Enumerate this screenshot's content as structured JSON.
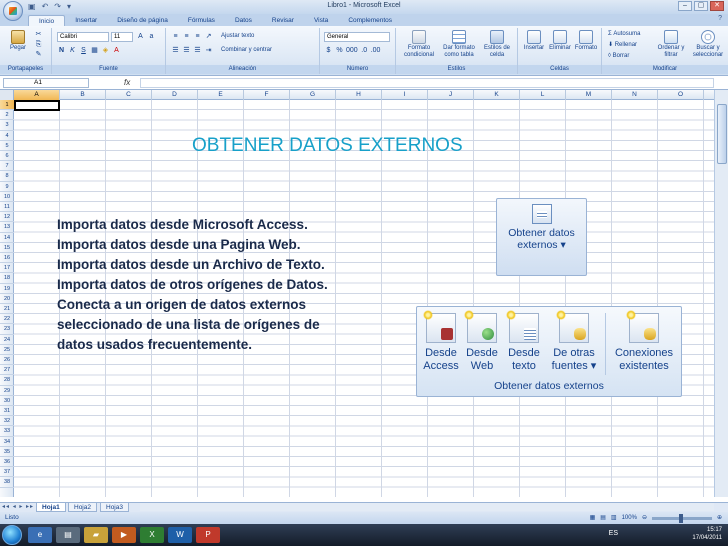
{
  "window": {
    "title": "Libro1 - Microsoft Excel"
  },
  "ribbon_tabs": [
    "Inicio",
    "Insertar",
    "Diseño de página",
    "Fórmulas",
    "Datos",
    "Revisar",
    "Vista",
    "Complementos"
  ],
  "ribbon": {
    "paste_label": "Pegar",
    "font_name": "Calibri",
    "font_size": "11",
    "wrap_text": "Ajustar texto",
    "merge_center": "Combinar y centrar",
    "number_format": "General",
    "conditional_format": "Formato condicional",
    "format_as_table": "Dar formato como tabla",
    "cell_styles": "Estilos de celda",
    "insert": "Insertar",
    "delete": "Eliminar",
    "format": "Formato",
    "autosum": "Autosuma",
    "fill": "Rellenar",
    "clear": "Borrar",
    "sort_filter": "Ordenar y filtrar",
    "find_select": "Buscar y seleccionar",
    "groups": {
      "clipboard": "Portapapeles",
      "font": "Fuente",
      "alignment": "Alineación",
      "number": "Número",
      "styles": "Estilos",
      "cells": "Celdas",
      "editing": "Modificar"
    }
  },
  "formula_bar": {
    "name_box": "A1",
    "fx": "fx"
  },
  "columns": [
    "A",
    "B",
    "C",
    "D",
    "E",
    "F",
    "G",
    "H",
    "I",
    "J",
    "K",
    "L",
    "M",
    "N",
    "O"
  ],
  "rows": [
    "1",
    "2",
    "3",
    "4",
    "5",
    "6",
    "7",
    "8",
    "9",
    "10",
    "11",
    "12",
    "13",
    "14",
    "15",
    "16",
    "17",
    "18",
    "19",
    "20",
    "21",
    "22",
    "23",
    "24",
    "25",
    "26",
    "27",
    "28",
    "29",
    "30",
    "31",
    "32",
    "33",
    "34",
    "35",
    "36",
    "37",
    "38"
  ],
  "content": {
    "heading": "OBTENER DATOS EXTERNOS",
    "lines": [
      "Importa datos desde Microsoft Access.",
      "Importa datos desde una Pagina Web.",
      "Importa datos desde un Archivo de Texto.",
      "Importa datos de otros orígenes de Datos.",
      "Conecta a un origen de datos externos",
      "seleccionado de una lista de orígenes de",
      "datos usados frecuentemente."
    ]
  },
  "obtain_button": {
    "line1": "Obtener datos",
    "line2": "externos ▾"
  },
  "external_group": {
    "buttons": [
      {
        "line1": "Desde",
        "line2": "Access"
      },
      {
        "line1": "Desde",
        "line2": "Web"
      },
      {
        "line1": "Desde",
        "line2": "texto"
      },
      {
        "line1": "De otras",
        "line2": "fuentes ▾"
      },
      {
        "line1": "Conexiones",
        "line2": "existentes"
      }
    ],
    "label": "Obtener datos externos"
  },
  "sheets": [
    "Hoja1",
    "Hoja2",
    "Hoja3"
  ],
  "status": {
    "text": "Listo",
    "zoom": "100%"
  },
  "taskbar": {
    "lang": "ES",
    "time": "15:17",
    "date": "17/04/2011"
  }
}
